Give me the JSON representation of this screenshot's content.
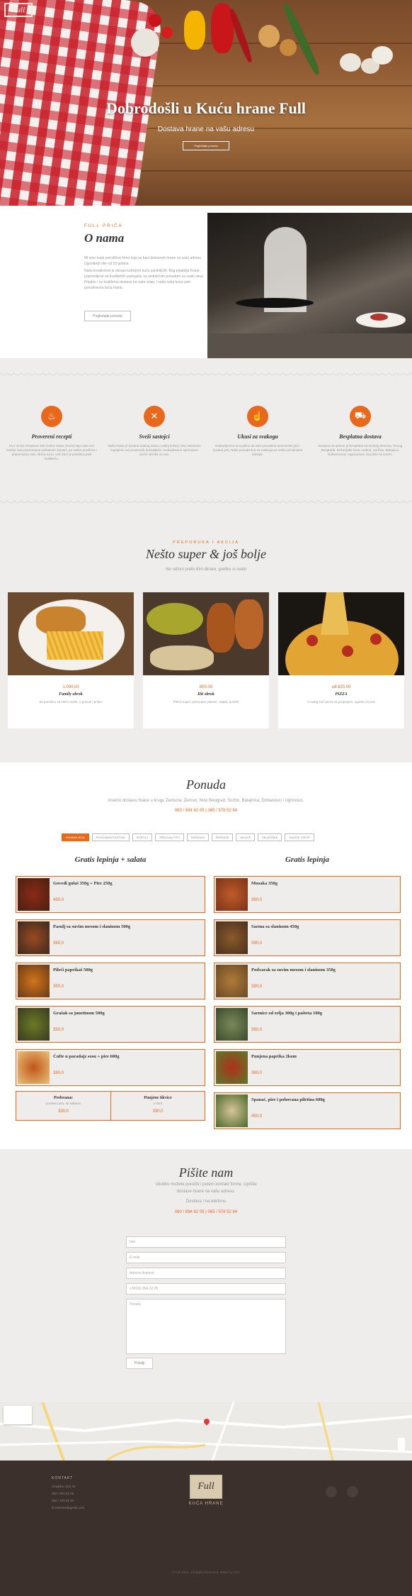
{
  "hero": {
    "logo": "Full",
    "title": "Dobrodošli u Kuću hrane Full",
    "subtitle": "Dostava hrane na vašu adresu",
    "button": "Pogledajte ponudu"
  },
  "about": {
    "tag": "FULL PRIČA",
    "title": "O nama",
    "p1": "Mi smo mala porodična firma koja se bavi dostavom hrane na vašu adresu. Ugostitelji više od 15 godina.",
    "p2": "Naša kreativnost je ukrasa kuhinjom kuću zanimljivih. Bog prijatelje hrane, pripremljene od kvalitetnih sastojaka, sa sedmičnim ponudom za svaki ukus. Prijatno i uz kvalitetnu dostavu na vaša vrata, i sada naša kuća vam punodnevna kuća hrane.",
    "button": "Pogledajte ponudu"
  },
  "features": [
    {
      "icon": "chef-hat-icon",
      "title": "Provereni recepti",
      "text": "Ovo se bio recepture svih Dobre Hrane (Kuća) koje nam već koriste nasi pripremama jedinstven domaći, po našim pravilima i pripremama. Bez obzira na to, vaš izbor je potrebno jesti kvalitetno."
    },
    {
      "icon": "utensils-icon",
      "title": "Sveži sastojci",
      "text": "Naša hrana je kuvana svakog dana u našoj kuhinji. Sve namirnice kupujemo od proverenih dobavljača i svakodnevno spremamo sveže obroke za vas."
    },
    {
      "icon": "thumb-up-icon",
      "title": "Ukusi za svakoga",
      "text": "Svakodnevno se trudimo da vam ponudimo raznovrsne jelo i kuvane jelo. Naša ponuda ima za svakoga po nešto od domaće kuhinje."
    },
    {
      "icon": "truck-icon",
      "title": "Besplatna dostava",
      "text": "Dostava na adresu je besplatna na teritoriji Zemuna, Novog Beograda, Bežanijske kose, Ledina, Surčina, Batajnice, Dobanovaca i Ugrinovaca. Naručite na vreme."
    }
  ],
  "specials": {
    "tag": "PREPORUKA I AKCIJA",
    "title": "Nešto super & još bolje",
    "subtitle": "Ne računi prebi lični dinare, grešku si svaki",
    "cards": [
      {
        "price": "1.000,00",
        "name": "Family obrok",
        "desc": "Za porodicu za četiri osobe, u ponudi i prilozi"
      },
      {
        "price": "800,00",
        "name": "Hit obrok",
        "desc": "Pileća supa i pohovane piletine, salata, pomfrit"
      },
      {
        "price": "od 820,00",
        "name": "PIZZA",
        "desc": "U našoj kući pizza sa punjenjem, ugodno za vas"
      }
    ]
  },
  "menu": {
    "title": "Ponuda",
    "subtitle": "Imamo dostavu hrane u krugu Zemuna: Zemun, Novi Beograd, Surčin, Batajnica, Dobanovci i Ugrinovci.",
    "phone": "060 / 894 62 05 | 065 / 578 52 84",
    "tabs": [
      "KUVANA JELA",
      "POHOVANA PILETINA",
      "ROŠTILJ",
      "SPECIJALITETI",
      "PAPAGAJI",
      "PEČENJE",
      "SALATE",
      "PALAČINKE",
      "SALATE TORTE"
    ],
    "left_title": "Gratis lepinja + salata",
    "right_title": "Gratis lepinja",
    "left": [
      {
        "name": "Goveđi gulaš 350g + Pire 250g",
        "price": "450,0"
      },
      {
        "name": "Pasulj sa suvim mesom i slaninom 500g",
        "price": "380,0"
      },
      {
        "name": "Pileći paprikaš 500g",
        "price": "350,0"
      },
      {
        "name": "Grašak sa junetinom 500g",
        "price": "350,0"
      },
      {
        "name": "Ćufte u paradajz sosu + pire 600g",
        "price": "380,0"
      }
    ],
    "right": [
      {
        "name": "Musaka 350g",
        "price": "390,0"
      },
      {
        "name": "Sarma sa slaninom 450g",
        "price": "390,0"
      },
      {
        "name": "Podvarak sa suvim mesom i slaninom 350g",
        "price": "390,0"
      },
      {
        "name": "Sarmice od zelja 300g i pašteta 100g",
        "price": "390,0"
      },
      {
        "name": "Punjena paprika 2kom",
        "price": "380,0"
      },
      {
        "name": "Spanać, pire i pohovana piletina 600g",
        "price": "450,0"
      }
    ],
    "drinks": [
      {
        "name": "Prebranac",
        "desc": "posebno jelo, sa salatom",
        "price": "330,0"
      },
      {
        "name": "Punjene tikvice",
        "desc": "2 kom",
        "price": "330,0"
      }
    ]
  },
  "contact": {
    "title": "Pišite nam",
    "sub1": "Ukoliko možete poručiti i putem kontakt forme. Upišite",
    "sub2": "dostave hrane na vašu adresu.",
    "sub3": "Dostava i na telefonu",
    "phone": "060 / 894 62 05 | 065 / 578 52 84",
    "placeholders": [
      "Ime",
      "E-mail",
      "Adresa dostave",
      "+38160 894 62 05",
      "Poruka"
    ],
    "button": "Pošalji"
  },
  "footer": {
    "heading": "KONTAKT",
    "lines": [
      "Gradska ulica 12",
      "060 / 894 62 05",
      "065 / 578 52 84",
      "kucahrane@gmail.com"
    ],
    "brand": "KUĆA HRANE",
    "copyright": "© Full 2019. All Rights Reserved. Made by CTO"
  },
  "colors": {
    "accent": "#e8691c",
    "footer": "#3b302b",
    "bg": "#efedeb"
  }
}
